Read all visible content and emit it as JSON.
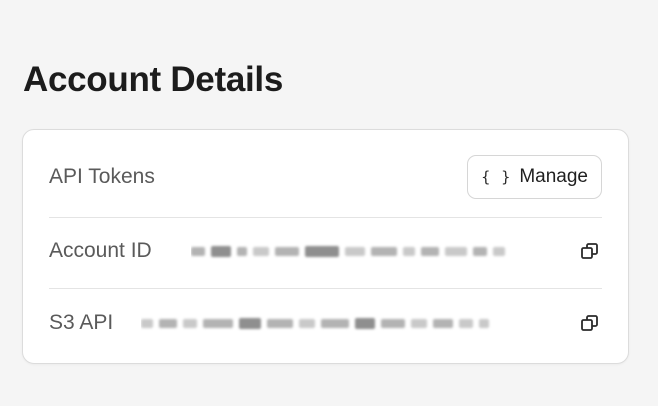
{
  "page": {
    "title": "Account Details"
  },
  "account_card": {
    "api_tokens": {
      "label": "API Tokens",
      "manage_button": {
        "icon": "code-braces-icon",
        "glyph": "{ }",
        "label": "Manage"
      }
    },
    "account_id": {
      "label": "Account ID",
      "value_redacted": true,
      "copy_icon": "copy-icon"
    },
    "s3_api": {
      "label": "S3 API",
      "value_redacted": true,
      "copy_icon": "copy-icon"
    }
  }
}
